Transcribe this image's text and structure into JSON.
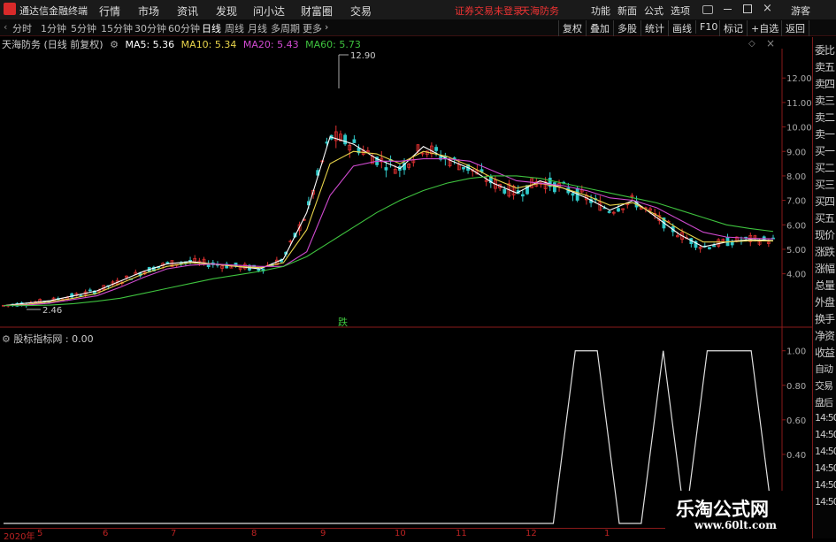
{
  "app": {
    "name": "通达信金融终端"
  },
  "menu": [
    "行情",
    "市场",
    "资讯",
    "发现",
    "问小达",
    "财富圈",
    "交易"
  ],
  "warning": [
    "证券交易未登录",
    "天海防务"
  ],
  "title_right": [
    "功能",
    "新面",
    "公式",
    "选项",
    "游客"
  ],
  "toolbar": {
    "periods": [
      "分时",
      "1分钟",
      "5分钟",
      "15分钟",
      "30分钟",
      "60分钟",
      "日线",
      "周线",
      "月线",
      "多周期",
      "更多"
    ],
    "active": "日线",
    "right_buttons": [
      "复权",
      "叠加",
      "多股",
      "统计",
      "画线",
      "F10",
      "标记",
      "+自选",
      "返回"
    ]
  },
  "legend": {
    "stock": "天海防务 (日线 前复权)",
    "ma5": "MA5: 5.36",
    "ma10": "MA10: 5.34",
    "ma20": "MA20: 5.43",
    "ma60": "MA60: 5.73"
  },
  "colors": {
    "ma5": "#ffffff",
    "ma10": "#e8d44a",
    "ma20": "#d04ad0",
    "ma60": "#3ec23e",
    "up": "#e03030",
    "down": "#30c8c8"
  },
  "annotations": {
    "high": "12.90",
    "low": "2.46",
    "marker": "跌"
  },
  "right_panel": [
    "委比",
    "卖五",
    "卖四",
    "卖三",
    "卖二",
    "卖一",
    "买一",
    "买二",
    "买三",
    "买四",
    "买五",
    "现价",
    "涨跌",
    "涨幅",
    "总量",
    "外盘",
    "换手",
    "净资",
    "收益",
    "自动",
    "交易",
    "盘后",
    "14:50",
    "14:50",
    "14:50",
    "14:50",
    "14:50",
    "14:50"
  ],
  "indicator": {
    "label": "股标指标网 : 0.00"
  },
  "xaxis": {
    "labels": [
      "2020年",
      "5",
      "6",
      "7",
      "8",
      "9",
      "10",
      "11",
      "12",
      "1"
    ]
  },
  "watermark": {
    "line1": "乐淘公式网",
    "line2": "www.60lt.com"
  },
  "chart_data": [
    {
      "type": "line",
      "title": "天海防务 (日线 前复权)",
      "y_ticks": [
        4.0,
        5.0,
        6.0,
        7.0,
        8.0,
        9.0,
        10.0,
        11.0,
        12.0
      ],
      "ylim": [
        2.0,
        13.2
      ],
      "series": [
        {
          "name": "MA5",
          "values": [
            2.7,
            2.8,
            2.9,
            3.1,
            3.3,
            3.7,
            4.1,
            4.4,
            4.5,
            4.4,
            4.3,
            4.2,
            4.6,
            6.5,
            9.6,
            9.3,
            8.7,
            8.3,
            9.2,
            8.7,
            8.3,
            7.7,
            7.3,
            7.8,
            7.5,
            7.1,
            6.6,
            7.0,
            6.3,
            5.6,
            5.1,
            5.3,
            5.4,
            5.36
          ]
        },
        {
          "name": "MA10",
          "values": [
            2.7,
            2.75,
            2.85,
            3.0,
            3.2,
            3.6,
            4.0,
            4.3,
            4.45,
            4.4,
            4.3,
            4.25,
            4.45,
            5.8,
            8.5,
            9.0,
            8.9,
            8.5,
            9.0,
            8.8,
            8.4,
            7.9,
            7.5,
            7.7,
            7.5,
            7.2,
            6.8,
            6.9,
            6.4,
            5.8,
            5.3,
            5.3,
            5.35,
            5.34
          ]
        },
        {
          "name": "MA20",
          "values": [
            2.7,
            2.72,
            2.8,
            2.95,
            3.1,
            3.45,
            3.85,
            4.2,
            4.35,
            4.4,
            4.35,
            4.3,
            4.3,
            4.9,
            7.2,
            8.4,
            8.6,
            8.6,
            8.7,
            8.7,
            8.6,
            8.2,
            7.8,
            7.7,
            7.6,
            7.4,
            7.1,
            7.0,
            6.7,
            6.2,
            5.7,
            5.5,
            5.45,
            5.43
          ]
        },
        {
          "name": "MA60",
          "values": [
            2.7,
            2.7,
            2.72,
            2.78,
            2.88,
            3.0,
            3.2,
            3.4,
            3.6,
            3.8,
            3.95,
            4.1,
            4.3,
            4.7,
            5.3,
            5.9,
            6.5,
            7.0,
            7.4,
            7.7,
            7.9,
            8.0,
            8.0,
            7.9,
            7.7,
            7.5,
            7.3,
            7.1,
            6.9,
            6.6,
            6.3,
            6.0,
            5.85,
            5.73
          ]
        }
      ]
    },
    {
      "type": "line",
      "title": "股标指标网",
      "y_ticks": [
        0.4,
        0.6,
        0.8,
        1.0
      ],
      "ylim": [
        0.0,
        1.06
      ],
      "series": [
        {
          "name": "股标指标网",
          "values": [
            0,
            0,
            0,
            0,
            0,
            0,
            0,
            0,
            0,
            0,
            0,
            0,
            0,
            0,
            0,
            0,
            0,
            0,
            0,
            0,
            0,
            0,
            0,
            0,
            0,
            0,
            1,
            1,
            0,
            0,
            1,
            0,
            1,
            1,
            1,
            0
          ]
        }
      ]
    }
  ]
}
